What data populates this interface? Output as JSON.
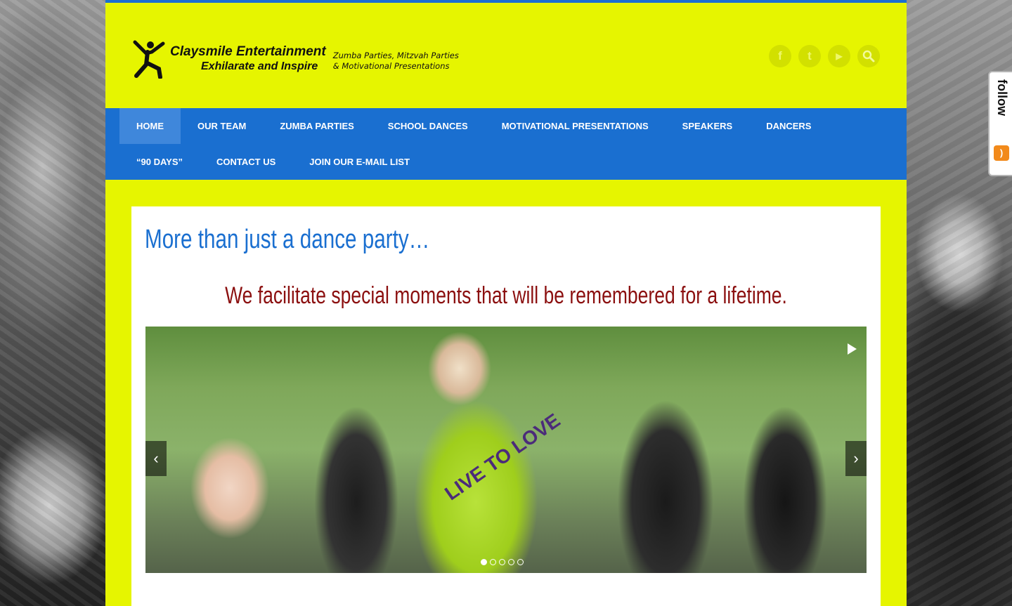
{
  "header": {
    "logo_name": "Claysmile Entertainment",
    "logo_tagline": "Exhilarate and Inspire",
    "logo_sub_line1": "Zumba Parties, Mitzvah Parties",
    "logo_sub_line2": "& Motivational Presentations",
    "social": [
      {
        "name": "facebook-icon",
        "glyph": "f"
      },
      {
        "name": "twitter-icon",
        "glyph": "t"
      },
      {
        "name": "youtube-icon",
        "glyph": "▶"
      },
      {
        "name": "search-icon",
        "glyph": "⚲"
      }
    ]
  },
  "nav": {
    "items": [
      {
        "label": "HOME",
        "active": true
      },
      {
        "label": "OUR TEAM"
      },
      {
        "label": "ZUMBA PARTIES"
      },
      {
        "label": "SCHOOL DANCES"
      },
      {
        "label": "MOTIVATIONAL PRESENTATIONS"
      },
      {
        "label": "SPEAKERS"
      },
      {
        "label": "DANCERS"
      },
      {
        "label": "“90 DAYS”"
      },
      {
        "label": "CONTACT US"
      },
      {
        "label": "JOIN OUR E-MAIL LIST"
      }
    ]
  },
  "main": {
    "headline": "More than just a dance party…",
    "tagline": "We facilitate special moments that will be remembered for a lifetime.",
    "slider": {
      "shirt_text": "LIVE TO LOVE",
      "prev_glyph": "‹",
      "next_glyph": "›",
      "dot_count": 5,
      "active_dot": 0
    }
  },
  "follow_widget": {
    "label": "follow",
    "rss_glyph": ")"
  },
  "colors": {
    "page_bg": "#e6f500",
    "nav_bg": "#1a6fd0",
    "headline": "#1a6fd0",
    "tagline": "#8b0f0f"
  }
}
